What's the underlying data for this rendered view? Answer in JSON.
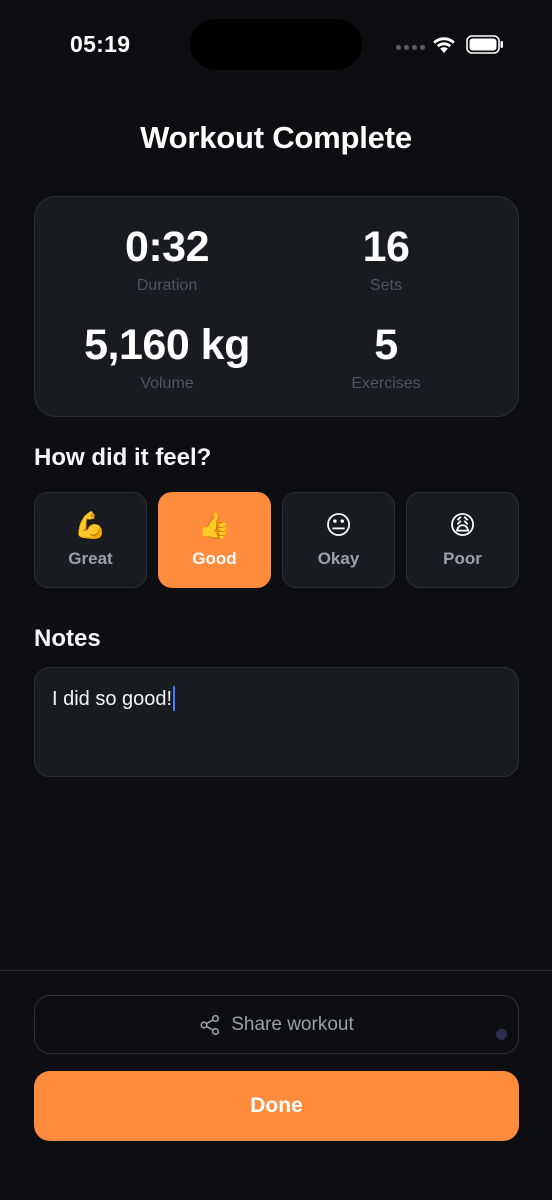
{
  "status_bar": {
    "time": "05:19"
  },
  "title": "Workout Complete",
  "stats": {
    "duration": {
      "value": "0:32",
      "label": "Duration"
    },
    "sets": {
      "value": "16",
      "label": "Sets"
    },
    "volume": {
      "value": "5,160 kg",
      "label": "Volume"
    },
    "exercises": {
      "value": "5",
      "label": "Exercises"
    }
  },
  "feel": {
    "heading": "How did it feel?",
    "selected": "Good",
    "options": [
      {
        "emoji": "💪",
        "label": "Great",
        "icon": "flexed-biceps-icon"
      },
      {
        "emoji": "👍",
        "label": "Good",
        "icon": "thumbs-up-icon"
      },
      {
        "emoji": "😐",
        "label": "Okay",
        "icon": "neutral-face-icon"
      },
      {
        "emoji": "😩",
        "label": "Poor",
        "icon": "weary-face-icon"
      }
    ]
  },
  "notes": {
    "heading": "Notes",
    "value": "I did so good!"
  },
  "share": {
    "label": "Share workout",
    "icon": "share-icon"
  },
  "done": {
    "label": "Done"
  },
  "colors": {
    "accent": "#ff8c3c",
    "background": "#0c0e11",
    "card": "#181b20",
    "caret": "#3d7bff"
  }
}
